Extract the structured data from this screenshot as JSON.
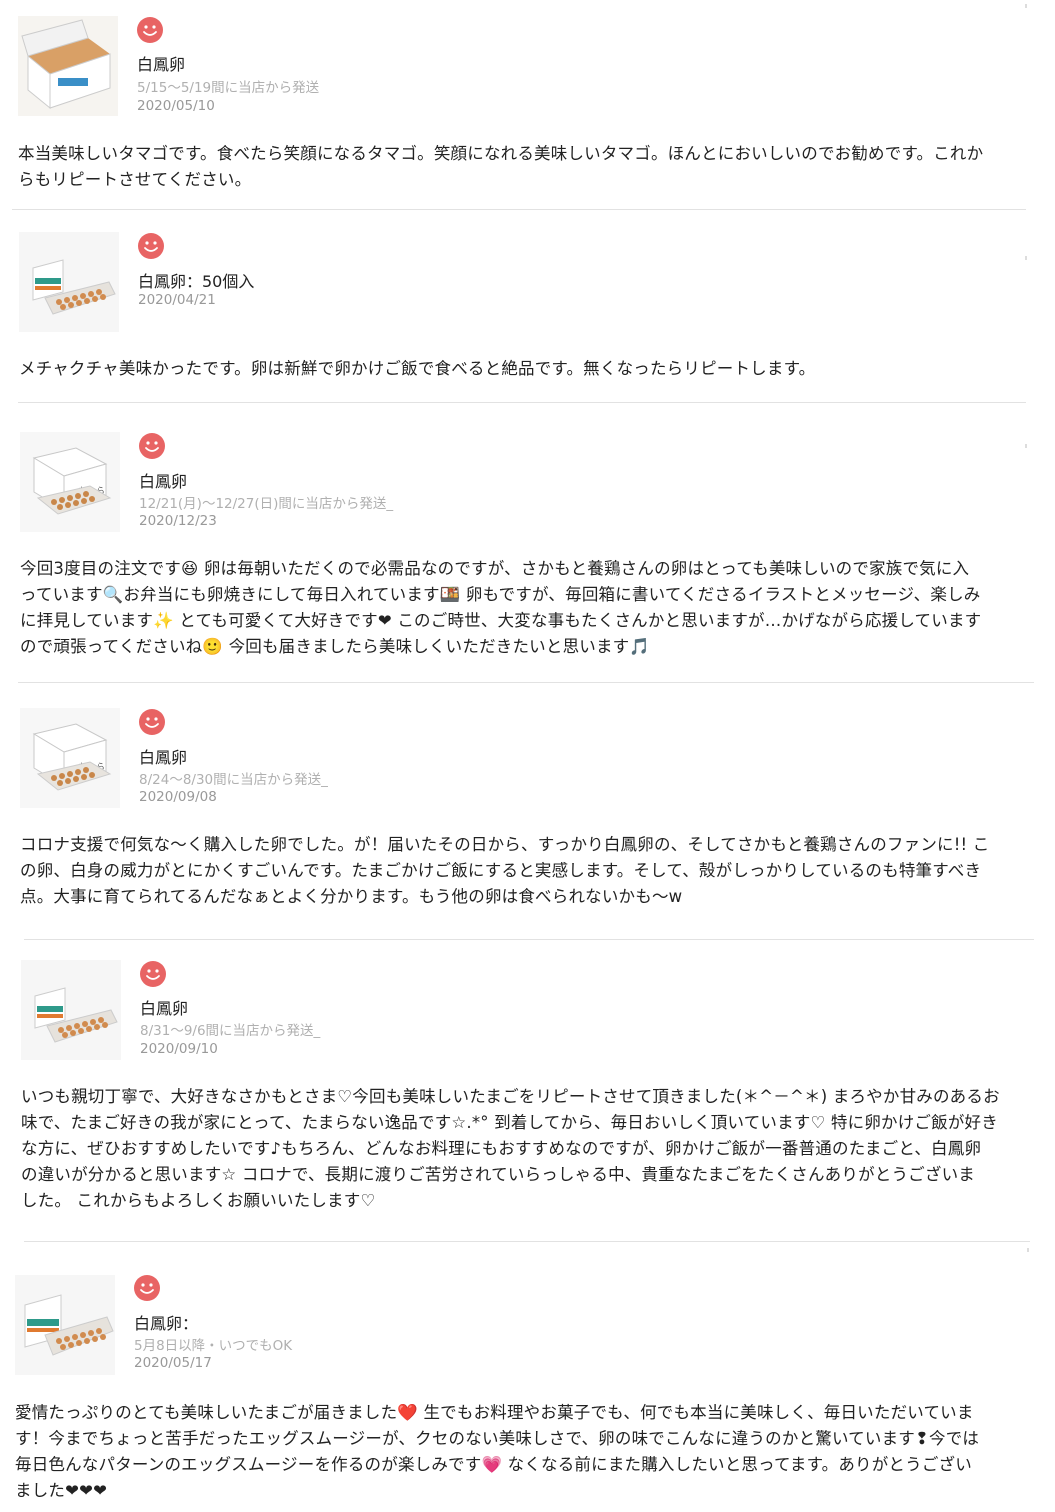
{
  "reviews": [
    {
      "product": "白鳳卵",
      "ship": "5/15～5/19間に当店から発送",
      "date": "2020/05/10",
      "body": "本当美味しいタマゴです。食べたら笑顔になるタマゴ。笑顔になれる美味しいタマゴ。ほんとにおいしいのでお勧めです。これか\nらもリピートさせてください。",
      "icon": "smile-face-icon"
    },
    {
      "product": "白鳳卵：50個入",
      "ship": "",
      "date": "2020/04/21",
      "body": "メチャクチャ美味かったです。卵は新鮮で卵かけご飯で食べると絶品です。無くなったらリピートします。",
      "icon": "smile-face-icon"
    },
    {
      "product": "白鳳卵",
      "ship": "12/21(月)～12/27(日)間に当店から発送_",
      "date": "2020/12/23",
      "body": "今回3度目の注文です😆 卵は毎朝いただくので必需品なのですが、さかもと養鶏さんの卵はとっても美味しいので家族で気に入\nっています🔍お弁当にも卵焼きにして毎日入れています🍱 卵もですが、毎回箱に書いてくださるイラストとメッセージ、楽しみ\nに拝見しています✨ とても可愛くて大好きです❤ このご時世、大変な事もたくさんかと思いますが…かげながら応援しています\nので頑張ってくださいね🙂 今回も届きましたら美味しくいただきたいと思います🎵",
      "icon": "smile-face-icon"
    },
    {
      "product": "白鳳卵",
      "ship": "8/24～8/30間に当店から発送_",
      "date": "2020/09/08",
      "body": "コロナ支援で何気な～く購入した卵でした。が！届いたその日から、すっかり白鳳卵の、そしてさかもと養鶏さんのファンに!! こ\nの卵、白身の威力がとにかくすごいんです。たまごかけご飯にすると実感します。そして、殻がしっかりしているのも特筆すべき\n点。大事に育てられてるんだなぁとよく分かります。もう他の卵は食べられないかも～w",
      "icon": "smile-face-icon"
    },
    {
      "product": "白鳳卵",
      "ship": "8/31～9/6間に当店から発送_",
      "date": "2020/09/10",
      "body": "いつも親切丁寧で、大好きなさかもとさま♡今回も美味しいたまごをリピートさせて頂きました(＊^－^＊) まろやか甘みのあるお\n味で、たまご好きの我が家にとって、たまらない逸品です☆.*° 到着してから、毎日おいしく頂いています♡ 特に卵かけご飯が好き\nな方に、ぜひおすすめしたいです♪もちろん、どんなお料理にもおすすめなのですが、卵かけご飯が一番普通のたまごと、白鳳卵\nの違いが分かると思います☆ コロナで、長期に渡りご苦労されていらっしゃる中、貴重なたまごをたくさんありがとうございま\nした。 これからもよろしくお願いいたします♡",
      "icon": "smile-face-icon"
    },
    {
      "product": "白鳳卵：",
      "ship": "5月8日以降・いつでもOK",
      "date": "2020/05/17",
      "body": "愛情たっぷりのとても美味しいたまごが届きました❤️ 生でもお料理やお菓子でも、何でも本当に美味しく、毎日いただいていま\nす！今までちょっと苦手だったエッグスムージーが、クセのない美味しさで、卵の味でこんなに違うのかと驚いています❢今では\n毎日色んなパターンのエッグスムージーを作るのが楽しみです💗 なくなる前にまた購入したいと思ってます。ありがとうござい\nました❤❤❤",
      "icon": "smile-face-icon"
    }
  ],
  "colors": {
    "smile": "#e86464",
    "text": "#222222",
    "muted": "#999999"
  }
}
